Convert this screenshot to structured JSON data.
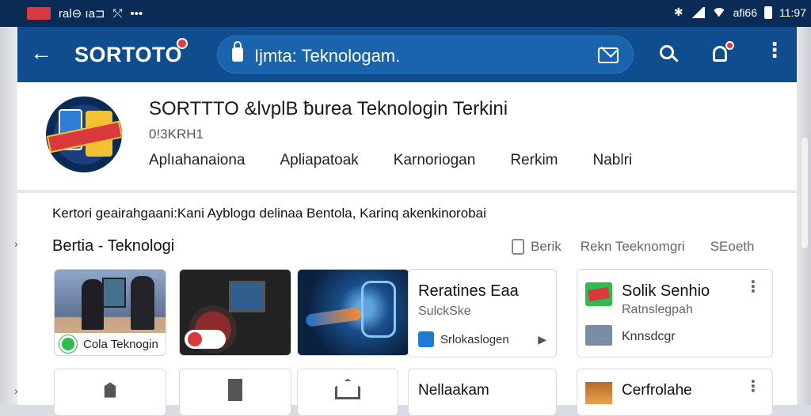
{
  "status": {
    "left_text": "ral⊖ ıa⊐",
    "time": "11:97",
    "right_text": "afi66"
  },
  "appbar": {
    "brand": "SORTOTO",
    "search_text": "Ijmta: Teknologam."
  },
  "profile": {
    "title": "SORTTTO &lvplB ƀurea Teknologin Terkini",
    "subtitle": "0!3KRH1",
    "tabs": [
      "Aplıahanaiona",
      "Apliapatoak",
      "Karnoriogan",
      "Rerkim",
      "Nablri"
    ]
  },
  "description": "Kertori geairahgaani:Kani Ayblogɑ delinaa Bentola, Karinq akenkinorobai",
  "section": {
    "title": "Bertia - Teknologi",
    "filters": [
      "Berik",
      "Rekn Teeknomgri",
      "SEoeth"
    ]
  },
  "thumb1_caption": "Cola Teknogin",
  "card1": {
    "title": "Reratines Eaa",
    "subtitle": "SulckSke",
    "foot": "Srlokaslogen"
  },
  "card2": {
    "title": "Solik Senhio",
    "subtitle": "Ratnslegpah",
    "foot": "Knnsdcgr"
  },
  "row2": {
    "card4_title": "Nellaakam",
    "card5_title": "Cerfrolahe"
  },
  "colors": {
    "statusbar": "#0b2b57",
    "appbar": "#0f4d8f",
    "accent_red": "#e2393d",
    "search_bg": "#1a63ad"
  },
  "icons": {
    "back": "arrow-left-icon",
    "lock": "lock-icon",
    "mail": "mail-icon",
    "search": "search-icon",
    "notifications": "bell-icon",
    "more": "more-vertical-icon"
  }
}
